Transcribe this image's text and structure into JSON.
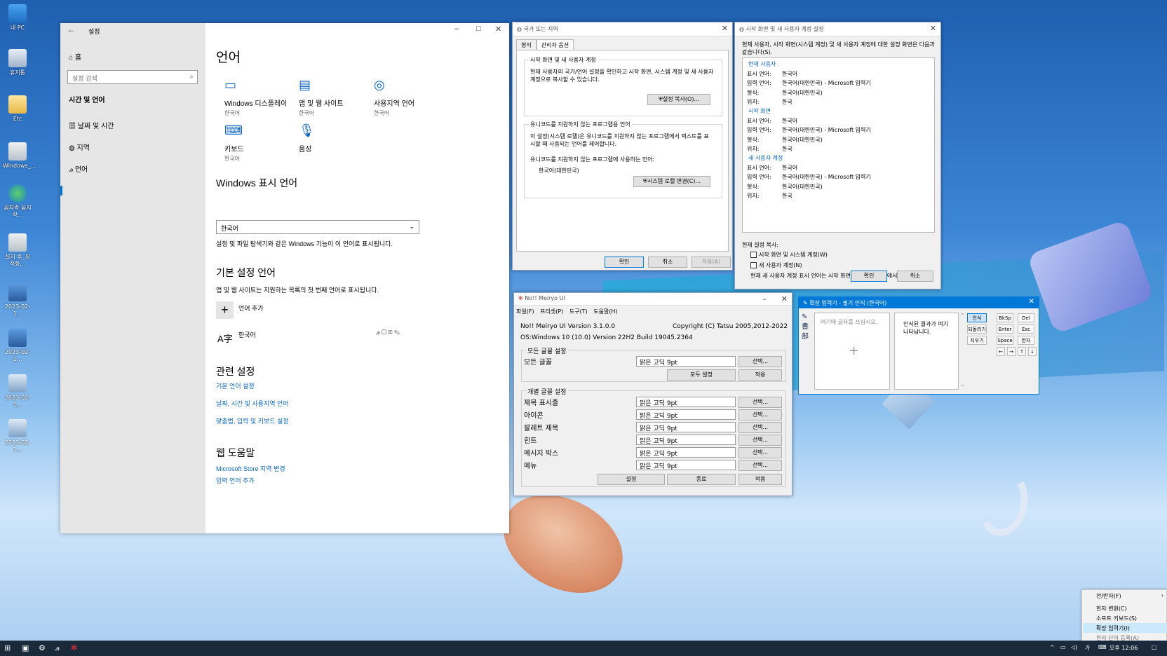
{
  "desktop": {
    "icons": [
      {
        "label": "내 PC"
      },
      {
        "label": "휴지통"
      },
      {
        "label": "Etc"
      },
      {
        "label": "Windows_..."
      },
      {
        "label": "꼼지락 꼼지락..."
      },
      {
        "label": "설치 후_최적화..."
      },
      {
        "label": "2023-02-1..."
      },
      {
        "label": "2023-02-1..."
      },
      {
        "label": "2023-02-1..."
      },
      {
        "label": "2023-02-1..."
      }
    ]
  },
  "settings": {
    "title": "설정",
    "home": "홈",
    "search_placeholder": "설정 검색",
    "section": "시간 및 언어",
    "nav": [
      "날짜 및 시간",
      "지역",
      "언어"
    ],
    "page_title": "언어",
    "tiles": [
      {
        "title": "Windows 디스플레이",
        "sub": "한국어"
      },
      {
        "title": "앱 및 웹 사이트",
        "sub": "한국어"
      },
      {
        "title": "사용지역 언어",
        "sub": "한국어"
      },
      {
        "title": "키보드",
        "sub": "한국어"
      },
      {
        "title": "음성",
        "sub": ""
      }
    ],
    "display_lang_header": "Windows 표시 언어",
    "display_lang_value": "한국어",
    "display_lang_note": "설정 및 파일 탐색기와 같은 Windows 기능이 이 언어로 표시됩니다.",
    "preferred_header": "기본 설정 언어",
    "preferred_note": "앱 및 웹 사이트는 지원하는 목록의 첫 번째 언어로 표시됩니다.",
    "add_language": "언어 추가",
    "language_item": "한국어",
    "related_header": "관련 설정",
    "related_links": [
      "기본 언어 설정",
      "날짜, 시간 및 사용지역 언어",
      "맞춤법, 입력 및 키보드 설정"
    ],
    "help_header": "웹 도움말",
    "help_links": [
      "Microsoft Store 지역 변경",
      "입력 언어 추가"
    ]
  },
  "region_dialog": {
    "title": "국가 또는 지역",
    "tabs": [
      "형식",
      "관리자 옵션"
    ],
    "group1_label": "시작 화면 및 새 사용자 계정",
    "group1_text": "현재 사용자의 국가/언어 설정을 확인하고 시작 화면, 시스템 계정 및 새 사용자 계정으로 복사할 수 있습니다.",
    "copy_button": "설정 복사(O)...",
    "group2_label": "유니코드를 지원하지 않는 프로그램용 언어",
    "group2_text": "이 설정(시스템 로캘)은 유니코드를 지원하지 않는 프로그램에서 텍스트를 표시할 때 사용되는 언어를 제어합니다.",
    "group2_sub": "유니코드를 지원하지 않는 프로그램에 사용하는 언어:",
    "current_locale": "한국어(대한민국)",
    "change_locale_button": "시스템 로캘 변경(C)...",
    "ok": "확인",
    "cancel": "취소",
    "apply": "적용(A)"
  },
  "welcome_dialog": {
    "title": "시작 화면 및 새 사용자 계정 설정",
    "intro": "현재 사용자, 시작 화면(시스템 계정) 및 새 사용자 계정에 대한 설정 화면은 다음과 같습니다(S).",
    "sections": [
      {
        "name": "현재 사용자",
        "rows": [
          [
            "표시 언어:",
            "한국어"
          ],
          [
            "입력 언어:",
            "한국어(대한민국) - Microsoft 입력기"
          ],
          [
            "형식:",
            "한국어(대한민국)"
          ],
          [
            "위치:",
            "한국"
          ]
        ]
      },
      {
        "name": "시작 화면",
        "rows": [
          [
            "표시 언어:",
            "한국어"
          ],
          [
            "입력 언어:",
            "한국어(대한민국) - Microsoft 입력기"
          ],
          [
            "형식:",
            "한국어(대한민국)"
          ],
          [
            "위치:",
            "한국"
          ]
        ]
      },
      {
        "name": "새 사용자 계정",
        "rows": [
          [
            "표시 언어:",
            "한국어"
          ],
          [
            "입력 언어:",
            "한국어(대한민국) - Microsoft 입력기"
          ],
          [
            "형식:",
            "한국어(대한민국)"
          ],
          [
            "위치:",
            "한국"
          ]
        ]
      }
    ],
    "copy_label": "현재 설정 복사:",
    "check1": "시작 화면 및 시스템 계정(W)",
    "check2": "새 사용자 계정(N)",
    "footer": "현재 새 사용자 계정 표시 언어는 시작 화면 및 시스템 언어에서 상속됩니다.",
    "ok": "확인",
    "cancel": "취소"
  },
  "meiryo": {
    "title": "No!! Meiryo UI",
    "menu": [
      "파일(F)",
      "프리셋(P)",
      "도구(T)",
      "도움말(H)"
    ],
    "version": "No!! Meiryo UI Version 3.1.0.0",
    "copyright": "Copyright (C) Tatsu 2005,2012-2022",
    "os": "OS:Windows 10 (10.0) Version 22H2 Build 19045.2364",
    "all_group": "모든 글꼴 설정",
    "all_label": "모든 글꼴",
    "font_value": "맑은 고딕   9pt",
    "select_btn": "선택...",
    "set_all_btn": "모두 설정",
    "apply_btn": "적용",
    "individual_group": "개별 글꼴 설정",
    "rows": [
      "제목 표시줄",
      "아이콘",
      "팔레트 제목",
      "힌트",
      "메시지 박스",
      "메뉴"
    ],
    "settings_btn": "설정",
    "exit_btn": "종료"
  },
  "ime": {
    "title": "확장 입력기 - 필기 인식 (한국어)",
    "placeholder": "여기에 글자를 쓰십시오.",
    "result_hint": "인식된 결과가 여기 나타납니다.",
    "buttons": [
      "인식",
      "되돌리기",
      "지우기"
    ],
    "keys": [
      "BkSp",
      "Del",
      "Enter",
      "Esc",
      "Space",
      "한자",
      "←",
      "→",
      "↑",
      "↓"
    ]
  },
  "context_menu": {
    "items": [
      "전/반자(F)",
      "한자 변환(C)",
      "소프트 키보드(S)",
      "확장 입력기(I)",
      "한자 단어 등록(A)"
    ]
  },
  "taskbar": {
    "clock": "오후 12:06"
  }
}
